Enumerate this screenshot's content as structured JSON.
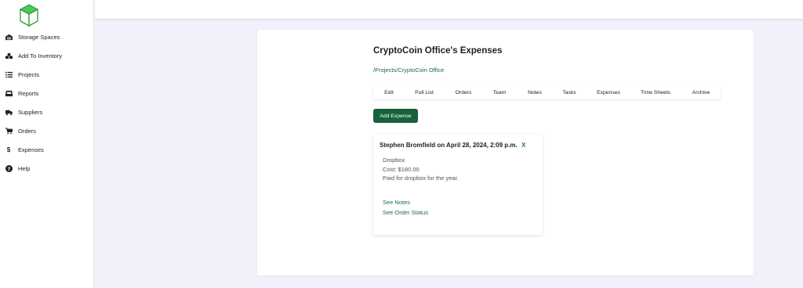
{
  "sidebar": {
    "items": [
      {
        "label": "Storage Spaces",
        "icon": "warehouse-icon"
      },
      {
        "label": "Add To Inventory",
        "icon": "boxes-icon"
      },
      {
        "label": "Projects",
        "icon": "list-icon"
      },
      {
        "label": "Reports",
        "icon": "inbox-icon"
      },
      {
        "label": "Suppliers",
        "icon": "truck-icon"
      },
      {
        "label": "Orders",
        "icon": "cart-icon"
      },
      {
        "label": "Expenses",
        "icon": "dollar-icon"
      },
      {
        "label": "Help",
        "icon": "question-circle-icon"
      }
    ]
  },
  "main": {
    "title": "CryptoCoin Office's Expenses",
    "breadcrumb": "/Projects/CryptoCoin Office",
    "tabs": [
      {
        "label": "Edit"
      },
      {
        "label": "Pull List"
      },
      {
        "label": "Orders"
      },
      {
        "label": "Team"
      },
      {
        "label": "Notes"
      },
      {
        "label": "Tasks"
      },
      {
        "label": "Expenses"
      },
      {
        "label": "Time Sheets"
      },
      {
        "label": "Archive"
      }
    ],
    "add_button": "Add Expense",
    "expense": {
      "header": "Stephen Bromfield on April 28, 2024, 2:09 p.m.",
      "delete": "X",
      "name": "Dropbox",
      "cost": "Cost: $180.00",
      "description": "Paid for dropbox for the year.",
      "see_notes": "See Notes",
      "see_order_status": "See Order Status"
    }
  },
  "colors": {
    "accent": "#17613b",
    "link": "#1f6b45",
    "background": "#f1f1fb",
    "logo": "#3fb24a"
  }
}
